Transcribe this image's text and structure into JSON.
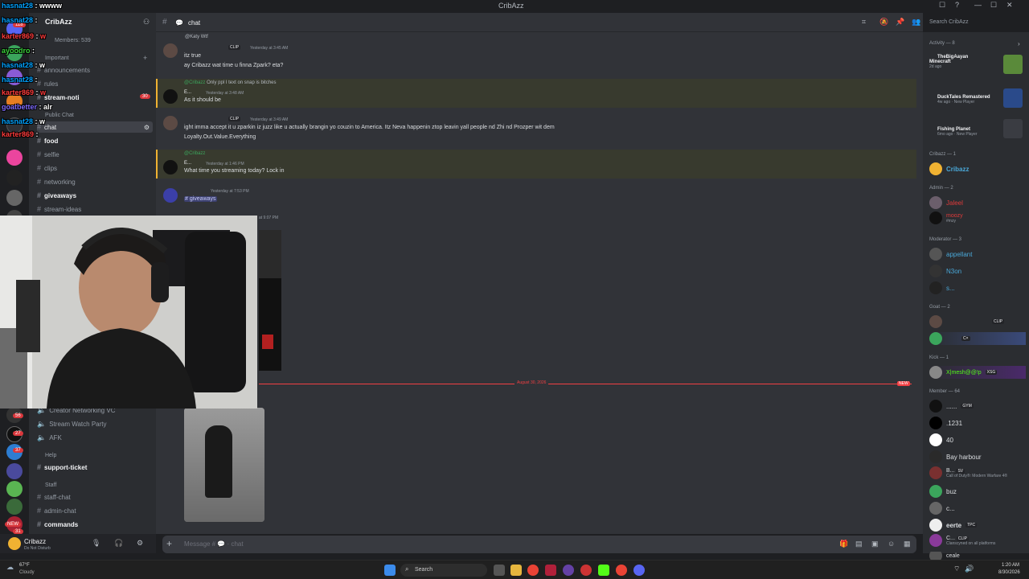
{
  "window": {
    "title": "CribAzz"
  },
  "server": {
    "name": "CribAzz",
    "members_label": "Members: 539",
    "important_label": "Important",
    "public_label": "Public Chat",
    "help_label": "Help",
    "staff_label": "Staff"
  },
  "channels": {
    "announcements": "announcements",
    "rules": "rules",
    "stream_noti": "stream-noti",
    "stream_noti_badge": "30",
    "chat": "chat",
    "food": "food",
    "selfie": "selfie",
    "clips": "clips",
    "networking": "networking",
    "giveaways": "giveaways",
    "stream_ideas": "stream-ideas",
    "creator_vc": "Creator Networking VC",
    "watch_party": "Stream Watch Party",
    "afk": "AFK",
    "support_ticket": "support-ticket",
    "staff_chat": "staff-chat",
    "admin_chat": "admin-chat",
    "commands": "commands"
  },
  "server_rail_badges": [
    "118",
    "1",
    "56",
    "27",
    "37",
    "NEW",
    "31"
  ],
  "user": {
    "name": "Cribazz",
    "status": "Do Not Disturb"
  },
  "header": {
    "channel": "chat",
    "search_placeholder": "Search CribAzz"
  },
  "messages": {
    "m1_reply": "@Katy Wtf",
    "m1_tag": "CLIP",
    "m1_time": "Yesterday at 3:45 AM",
    "m1_line1": "itz true",
    "m1_line2": "ay Cribazz wat time u finna Zpark? eta?",
    "m2_reply": "@Cribazz",
    "m2_reply_text": "Only ppl I text on snap is bitches",
    "m2_name": "E...",
    "m2_time": "Yesterday at 3:48 AM",
    "m2_text": "As it should be",
    "m3_tag": "CLIP",
    "m3_time": "Yesterday at 3:49 AM",
    "m3_line1": "ight imma accept it u zparkin iz juzz like u actually brangin yo couzin to America. Itz Neva happenin ztop leavin yall people nd Zhi nd Prozper wit dem",
    "m3_line2": "Loyalty.Out.Value.Everything",
    "m4_reply": "@Cribazz",
    "m4_name": "E...",
    "m4_time": "Yesterday at 1:46 PM",
    "m4_text": "What time you streaming today? Lock in",
    "m5_time": "Yesterday at 7:53 PM",
    "m5_text": "giveaways",
    "m6_time": "at 9:07 PM",
    "divider_date": "August 30, 2026",
    "divider_new": "NEW"
  },
  "composer": {
    "placeholder": "Message #",
    "placeholder_channel": "chat"
  },
  "activity": {
    "title": "Activity — 8",
    "items": [
      {
        "name": "TheBigAayan",
        "game": "Minecraft",
        "sub": "2d ago"
      },
      {
        "name": "DuckTales Remastered",
        "sub": "4w ago",
        "sub2": "New Player"
      },
      {
        "name": "Fishing Planet",
        "sub": "6mo ago",
        "sub2": "New Player"
      }
    ]
  },
  "member_groups": {
    "cribazz": "Cribazz — 1",
    "admin": "Admin — 2",
    "moderator": "Moderator — 3",
    "goat": "Goat — 2",
    "kick": "Kick — 1",
    "member": "Member — 64"
  },
  "members": {
    "cribazz": "Cribazz",
    "jaleel": "Jaleel",
    "moozy": "moozy",
    "moozy_sub": "#mzy",
    "appellant": "appellant",
    "n3on": "N3on",
    "s": "s...",
    "goat1_tag": "CLIP",
    "goat2_tag": "C×",
    "kick1": "X|mesh@@!p",
    "kick1_tag": "XSG",
    "m1": "......",
    "m1_tag": "GYM",
    "m2": ".1231",
    "m3": "40",
    "m4": "Bay harbour",
    "m5": "B...",
    "m5_tag": "SV",
    "m5_sub": "Call of Duty®: Modern Warfare 4®",
    "m6": "buz",
    "m7": "c...",
    "m8": "eerte",
    "m8_tag": "TPC",
    "m9": "C...",
    "m9_tag": "CLIP",
    "m9_sub": "Clanscyned on all platforms",
    "m10": "ceale"
  },
  "overlay_chat": [
    {
      "name": "hasnat28",
      "msg": "wwww",
      "color": "#00a2ff"
    },
    {
      "name": "hasnat28",
      "msg": "",
      "color": "#00a2ff"
    },
    {
      "name": "karter869",
      "msg": "w",
      "color": "#ff3b3b"
    },
    {
      "name": "ayoodro",
      "msg": "",
      "color": "#3bd13b"
    },
    {
      "name": "hasnat28",
      "msg": "w",
      "color": "#00a2ff"
    },
    {
      "name": "hasnat28",
      "msg": "",
      "color": "#00a2ff"
    },
    {
      "name": "karter869",
      "msg": "w",
      "color": "#ff3b3b"
    },
    {
      "name": "goatbetter",
      "msg": "alr",
      "color": "#7e6bff"
    },
    {
      "name": "hasnat28",
      "msg": "w",
      "color": "#00a2ff"
    },
    {
      "name": "karter869",
      "msg": "",
      "color": "#ff3b3b"
    }
  ],
  "taskbar": {
    "weather_temp": "67°F",
    "weather_desc": "Cloudy",
    "search": "Search",
    "time": "1:20 AM",
    "date": "8/30/2026"
  },
  "colors": {
    "accent": "#5865f2",
    "mention_bg": "#383a2e",
    "red": "#f23f43",
    "green": "#23a55a",
    "yellow": "#f0b232"
  }
}
